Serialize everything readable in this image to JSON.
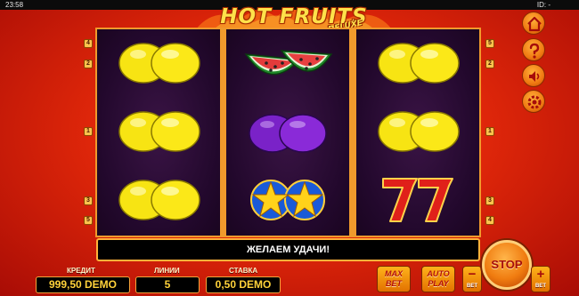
{
  "status_bar": {
    "time": "23:58",
    "id_label": "ID: -"
  },
  "logo": {
    "title": "HOT FRUITS",
    "subtitle": "DELUXE"
  },
  "reels": [
    [
      "lemon",
      "lemon",
      "lemon"
    ],
    [
      "watermelon",
      "plum",
      "stars"
    ],
    [
      "lemon",
      "lemon",
      "sevens"
    ]
  ],
  "line_markers": {
    "left": [
      "4",
      "2",
      "1",
      "3",
      "5"
    ],
    "right": [
      "5",
      "2",
      "1",
      "3",
      "4"
    ]
  },
  "message": "ЖЕЛАЕМ УДАЧИ!",
  "controls": {
    "credit_label": "КРЕДИТ",
    "credit_value": "999,50 DEMO",
    "lines_label": "ЛИНИИ",
    "lines_value": "5",
    "bet_label": "СТАВКА",
    "bet_value": "0,50 DEMO",
    "max_bet_line1": "MAX",
    "max_bet_line2": "BET",
    "auto_play_line1": "AUTO",
    "auto_play_line2": "PLAY",
    "stop_label": "STOP",
    "bet_minus_symbol": "−",
    "bet_minus_label": "BET",
    "bet_plus_symbol": "+",
    "bet_plus_label": "BET"
  },
  "side_buttons": [
    "home-icon",
    "help-icon",
    "sound-icon",
    "settings-icon"
  ],
  "colors": {
    "background": "#e2280a",
    "reel_frame": "#f09a2c",
    "reel_bg": "#22082c",
    "value_text": "#ffd23a",
    "button_orange": "#f07c10"
  }
}
